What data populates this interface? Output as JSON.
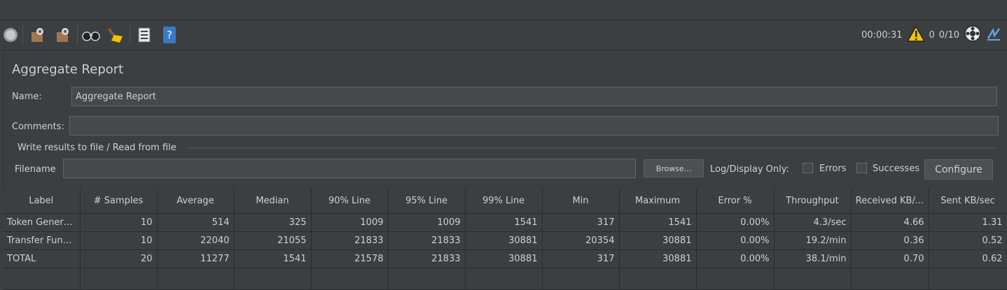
{
  "toolbar": {
    "icons": [
      "stop-icon",
      "remote-start-icon",
      "remote-stop-icon",
      "search-icon",
      "clear-icon",
      "function-helper-icon",
      "help-icon"
    ],
    "timer": "00:00:31",
    "warnings": "0",
    "threads": "0/10"
  },
  "panel": {
    "title": "Aggregate Report",
    "name_label": "Name:",
    "name_value": "Aggregate Report",
    "comments_label": "Comments:",
    "comments_value": "",
    "group_label": "Write results to file / Read from file",
    "filename_label": "Filename",
    "filename_value": "",
    "browse": "Browse...",
    "log_display_label": "Log/Display Only:",
    "errors_label": "Errors",
    "successes_label": "Successes",
    "configure": "Configure"
  },
  "table": {
    "headers": [
      "Label",
      "# Samples",
      "Average",
      "Median",
      "90% Line",
      "95% Line",
      "99% Line",
      "Min",
      "Maximum",
      "Error %",
      "Throughput",
      "Received KB/...",
      "Sent KB/sec"
    ],
    "rows": [
      [
        "Token Genera...",
        "10",
        "514",
        "325",
        "1009",
        "1009",
        "1541",
        "317",
        "1541",
        "0.00%",
        "4.3/sec",
        "4.66",
        "1.31"
      ],
      [
        "Transfer Fund...",
        "10",
        "22040",
        "21055",
        "21833",
        "21833",
        "30881",
        "20354",
        "30881",
        "0.00%",
        "19.2/min",
        "0.36",
        "0.52"
      ],
      [
        "TOTAL",
        "20",
        "11277",
        "1541",
        "21578",
        "21833",
        "30881",
        "317",
        "30881",
        "0.00%",
        "38.1/min",
        "0.70",
        "0.62"
      ]
    ]
  }
}
